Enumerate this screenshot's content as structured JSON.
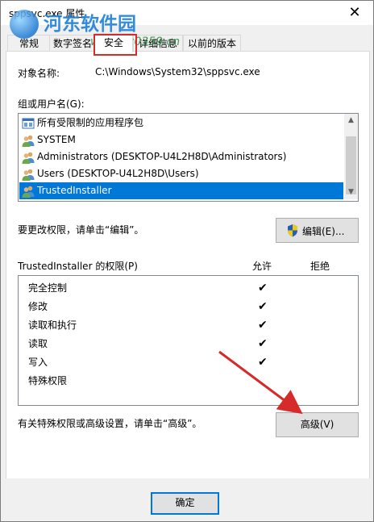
{
  "window": {
    "title": "sppsvc.exe 属性",
    "close_glyph": "✕"
  },
  "watermark": {
    "text": "河东软件园",
    "url": "www.pc0359.cn"
  },
  "tabs": [
    {
      "label": "常规"
    },
    {
      "label": "数字签名"
    },
    {
      "label": "安全"
    },
    {
      "label": "详细信息"
    },
    {
      "label": "以前的版本"
    }
  ],
  "security": {
    "object_name_label": "对象名称:",
    "object_name_value": "C:\\Windows\\System32\\sppsvc.exe",
    "group_label": "组或用户名(G):",
    "users": [
      {
        "name": "所有受限制的应用程序包",
        "icon": "package-icon",
        "selected": false
      },
      {
        "name": "SYSTEM",
        "icon": "user-group-icon",
        "selected": false
      },
      {
        "name": "Administrators (DESKTOP-U4L2H8D\\Administrators)",
        "icon": "user-group-icon",
        "selected": false
      },
      {
        "name": "Users (DESKTOP-U4L2H8D\\Users)",
        "icon": "user-group-icon",
        "selected": false
      },
      {
        "name": "TrustedInstaller",
        "icon": "user-group-icon",
        "selected": true
      }
    ],
    "edit_hint": "要更改权限，请单击“编辑”。",
    "edit_button": "编辑(E)...",
    "permissions_label": "TrustedInstaller 的权限(P)",
    "allow_header": "允许",
    "deny_header": "拒绝",
    "permissions": [
      {
        "name": "完全控制",
        "allow": true,
        "deny": false
      },
      {
        "name": "修改",
        "allow": true,
        "deny": false
      },
      {
        "name": "读取和执行",
        "allow": true,
        "deny": false
      },
      {
        "name": "读取",
        "allow": true,
        "deny": false
      },
      {
        "name": "写入",
        "allow": true,
        "deny": false
      },
      {
        "name": "特殊权限",
        "allow": false,
        "deny": false
      }
    ],
    "check_glyph": "✔",
    "advanced_hint": "有关特殊权限或高级设置，请单击“高级”。",
    "advanced_button": "高级(V)"
  },
  "footer": {
    "ok_button": "确定"
  },
  "colors": {
    "selection": "#0078d7",
    "annotation_red": "#d62b2b"
  }
}
